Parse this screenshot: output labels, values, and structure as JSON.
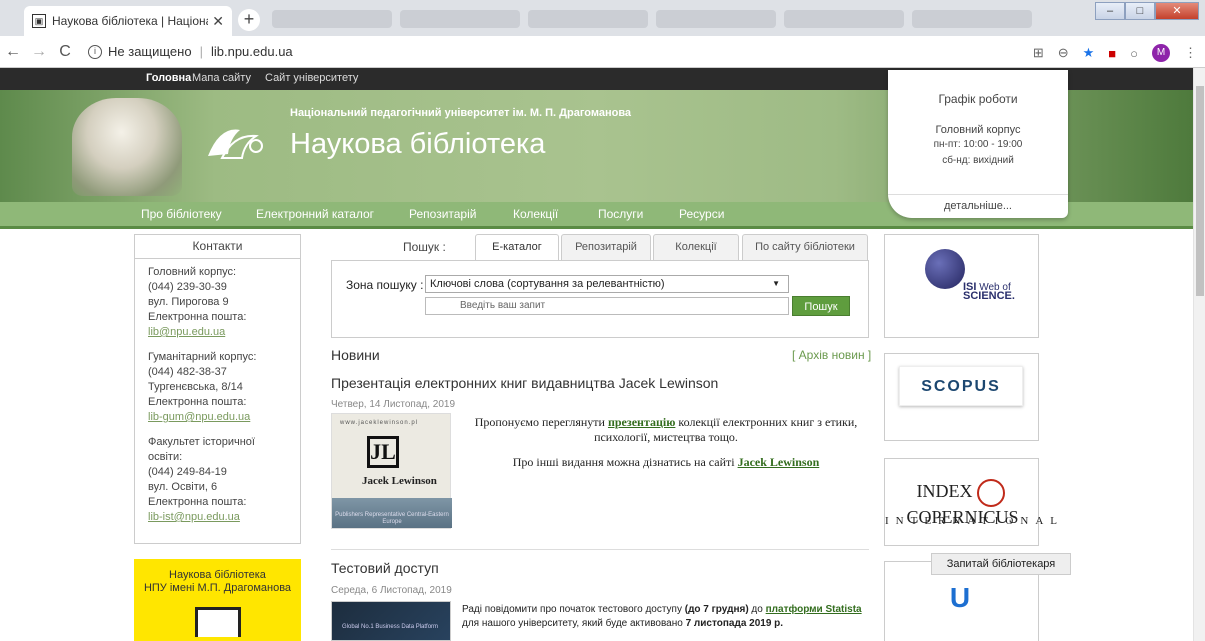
{
  "browser": {
    "tab_title": "Наукова бібліотека | Національ",
    "tab_close": "✕",
    "new_tab": "+",
    "secure_text": "Не защищено",
    "url": "lib.npu.edu.ua",
    "avatar": "M",
    "win_min": "–",
    "win_max": "□",
    "win_close": "✕"
  },
  "topnav": {
    "home": "Головна",
    "sitemap": "Мапа сайту",
    "university": "Сайт університету"
  },
  "banner": {
    "subtitle": "Національний педагогічний університет ім. М. П. Драгоманова",
    "title": "Наукова бібліотека"
  },
  "mainnav": [
    "Про бібліотеку",
    "Електронний каталог",
    "Репозитарій",
    "Колекції",
    "Послуги",
    "Ресурси"
  ],
  "schedule": {
    "heading": "Графік роботи",
    "building": "Головний корпус",
    "weekdays": "пн-пт: 10:00 - 19:00",
    "weekend": "сб-нд: вихідний",
    "more": "детальніше..."
  },
  "contacts": {
    "heading": "Контакти",
    "blocks": [
      {
        "name": "Головний корпус:",
        "phone": "(044) 239-30-39",
        "address": "вул. Пирогова 9",
        "email_label": "Електронна пошта:",
        "email": "lib@npu.edu.ua"
      },
      {
        "name": "Гуманітарний корпус:",
        "phone": "(044) 482-38-37",
        "address": "Тургенєвська, 8/14",
        "email_label": "Електронна пошта:",
        "email": "lib-gum@npu.edu.ua"
      },
      {
        "name": "Факультет історичної освіти:",
        "phone": "(044) 249-84-19",
        "address": "вул. Освіти, 6",
        "email_label": "Електронна пошта:",
        "email": "lib-ist@npu.edu.ua"
      }
    ]
  },
  "libcard": {
    "line1": "Наукова бібліотека",
    "line2": "НПУ імені М.П. Драгоманова"
  },
  "search": {
    "label": "Пошук :",
    "tabs": [
      "Е-каталог",
      "Репозитарій",
      "Колекції",
      "По сайту бібліотеки"
    ],
    "zone_label": "Зона пошуку :",
    "zone_value": "Ключові слова (сортування за релевантністю)",
    "placeholder": "Введіть ваш запит",
    "button": "Пошук"
  },
  "news": {
    "heading": "Новини",
    "archive": "[ Архів новин ]",
    "items": [
      {
        "title": "Презентація електронних книг видавництва Jacek Lewinson",
        "date": "Четвер, 14 Листопад, 2019",
        "img_url": "www.jaceklewinson.pl",
        "img_brand": "Jacek Lewinson",
        "img_foot": "Publishers Representative Central-Eastern Europe",
        "p1_before": "Пропонуємо переглянути ",
        "p1_link": "презентацію",
        "p1_after": " колекції електронних книг з етики, психології, мистецтва тощо.",
        "p2_before": "Про інші видання можна дізнатись на сайті ",
        "p2_link": "Jacek Lewinson"
      },
      {
        "title": "Тестовий доступ",
        "date": "Середа, 6 Листопад, 2019",
        "img_text": "Global No.1 Business Data Platform",
        "t1": "Раді повідомити про початок тестового доступу ",
        "t2": "(до 7 грудня)",
        "t3": " до ",
        "t4": "платформи Statista",
        "t5": " для нашого університету, який буде активовано ",
        "t6": "7 листопада 2019 р."
      }
    ]
  },
  "resources": {
    "wos_isi": "ISI",
    "wos_line1": "Web of",
    "wos_line2": "SCIENCE.",
    "scopus": "SCOPUS",
    "ic_left": "INDEX",
    "ic_right": "COPERNICUS",
    "ic_bottom": "INTERNATIONAL",
    "u_logo": "U"
  },
  "ask": "Запитай бібліотекаря"
}
